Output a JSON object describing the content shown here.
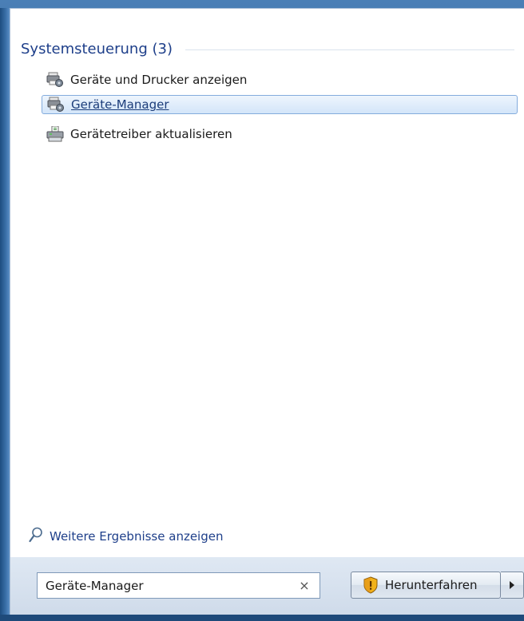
{
  "section": {
    "title": "Systemsteuerung (3)"
  },
  "results": [
    {
      "label": "Geräte und Drucker anzeigen",
      "icon": "devices-printers-icon",
      "selected": false
    },
    {
      "label": "Geräte-Manager",
      "icon": "device-manager-icon",
      "selected": true
    },
    {
      "label": "Gerätetreiber aktualisieren",
      "icon": "driver-update-icon",
      "selected": false
    }
  ],
  "more_results": {
    "label": "Weitere Ergebnisse anzeigen",
    "icon": "search-icon"
  },
  "search": {
    "value": "Geräte-Manager",
    "clear_icon": "clear-icon",
    "clear_glyph": "×"
  },
  "shutdown": {
    "label": "Herunterfahren",
    "icon": "uac-shield-icon",
    "arrow_icon": "arrow-right-icon"
  },
  "colors": {
    "accent_text": "#1e3f8a",
    "selection_border": "#84acdd",
    "selection_fill": "#d3e5f9",
    "frame": "#2e5f93"
  }
}
